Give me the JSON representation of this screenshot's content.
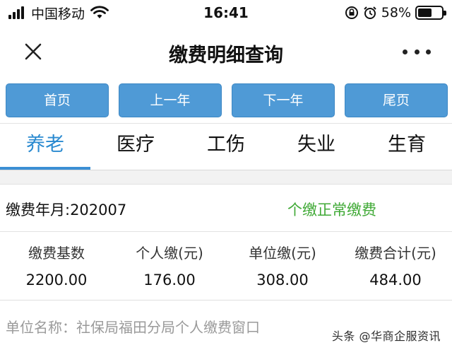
{
  "status_bar": {
    "carrier": "中国移动",
    "time": "16:41",
    "battery_percent": "58%",
    "battery_level": 0.58,
    "icons": [
      "signal-icon",
      "wifi-icon",
      "rotation-lock-icon",
      "alarm-icon",
      "battery-icon"
    ]
  },
  "nav": {
    "title": "缴费明细查询",
    "close_icon": "close-icon",
    "more_icon": "more-icon"
  },
  "page_buttons": {
    "first": "首页",
    "prev_year": "上一年",
    "next_year": "下一年",
    "last": "尾页",
    "color": "#4f9ad6"
  },
  "tabs": [
    {
      "label": "养老",
      "active": true
    },
    {
      "label": "医疗",
      "active": false
    },
    {
      "label": "工伤",
      "active": false
    },
    {
      "label": "失业",
      "active": false
    },
    {
      "label": "生育",
      "active": false
    }
  ],
  "record": {
    "period_label": "缴费年月:202007",
    "status": "个缴正常缴费",
    "status_color": "#3fa935",
    "columns": [
      {
        "header": "缴费基数",
        "value": "2200.00"
      },
      {
        "header": "个人缴(元)",
        "value": "176.00"
      },
      {
        "header": "单位缴(元)",
        "value": "308.00"
      },
      {
        "header": "缴费合计(元)",
        "value": "484.00"
      }
    ],
    "unit_name": "单位名称：社保局福田分局个人缴费窗口"
  },
  "watermark": "头条 @华商企服资讯",
  "accent_color": "#2a8ad0"
}
